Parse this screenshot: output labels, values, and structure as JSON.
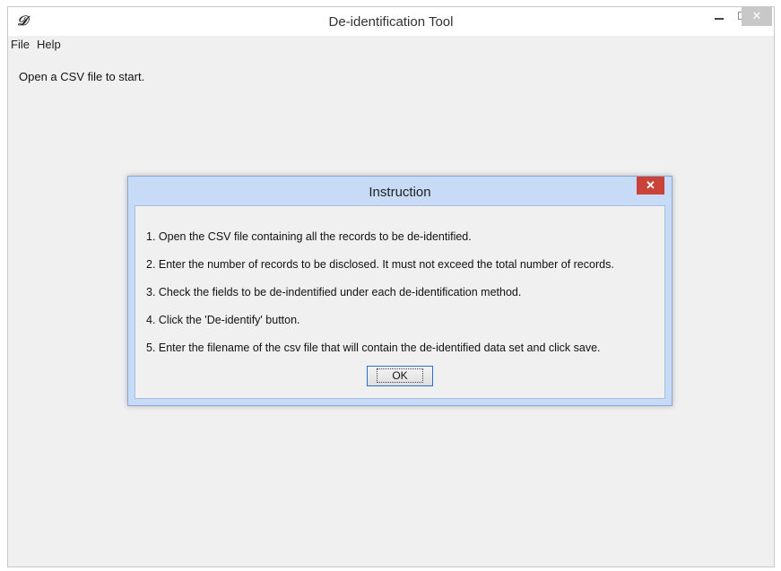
{
  "window": {
    "title": "De-identification Tool",
    "icon_glyph": "𝒟",
    "controls": {
      "minimize": "–",
      "maximize": "□",
      "close": "✕"
    }
  },
  "menubar": {
    "items": [
      "File",
      "Help"
    ]
  },
  "status_text": "Open a CSV file to start.",
  "dialog": {
    "title": "Instruction",
    "close": "✕",
    "instructions": [
      "1. Open the CSV file containing all the records to be de-identified.",
      "2. Enter the number of records to be disclosed. It must not exceed the total number of records.",
      "3. Check the fields to be de-indentified under each de-identification method.",
      "4. Click the 'De-identify' button.",
      "5. Enter the filename of the csv file that will contain the de-identified data set and click save."
    ],
    "ok_label": "OK"
  },
  "colors": {
    "dialog_frame": "#c7dbf6",
    "dialog_close": "#c94339",
    "window_bg": "#f0f0f0",
    "button_focus_border": "#2d6fbf"
  }
}
